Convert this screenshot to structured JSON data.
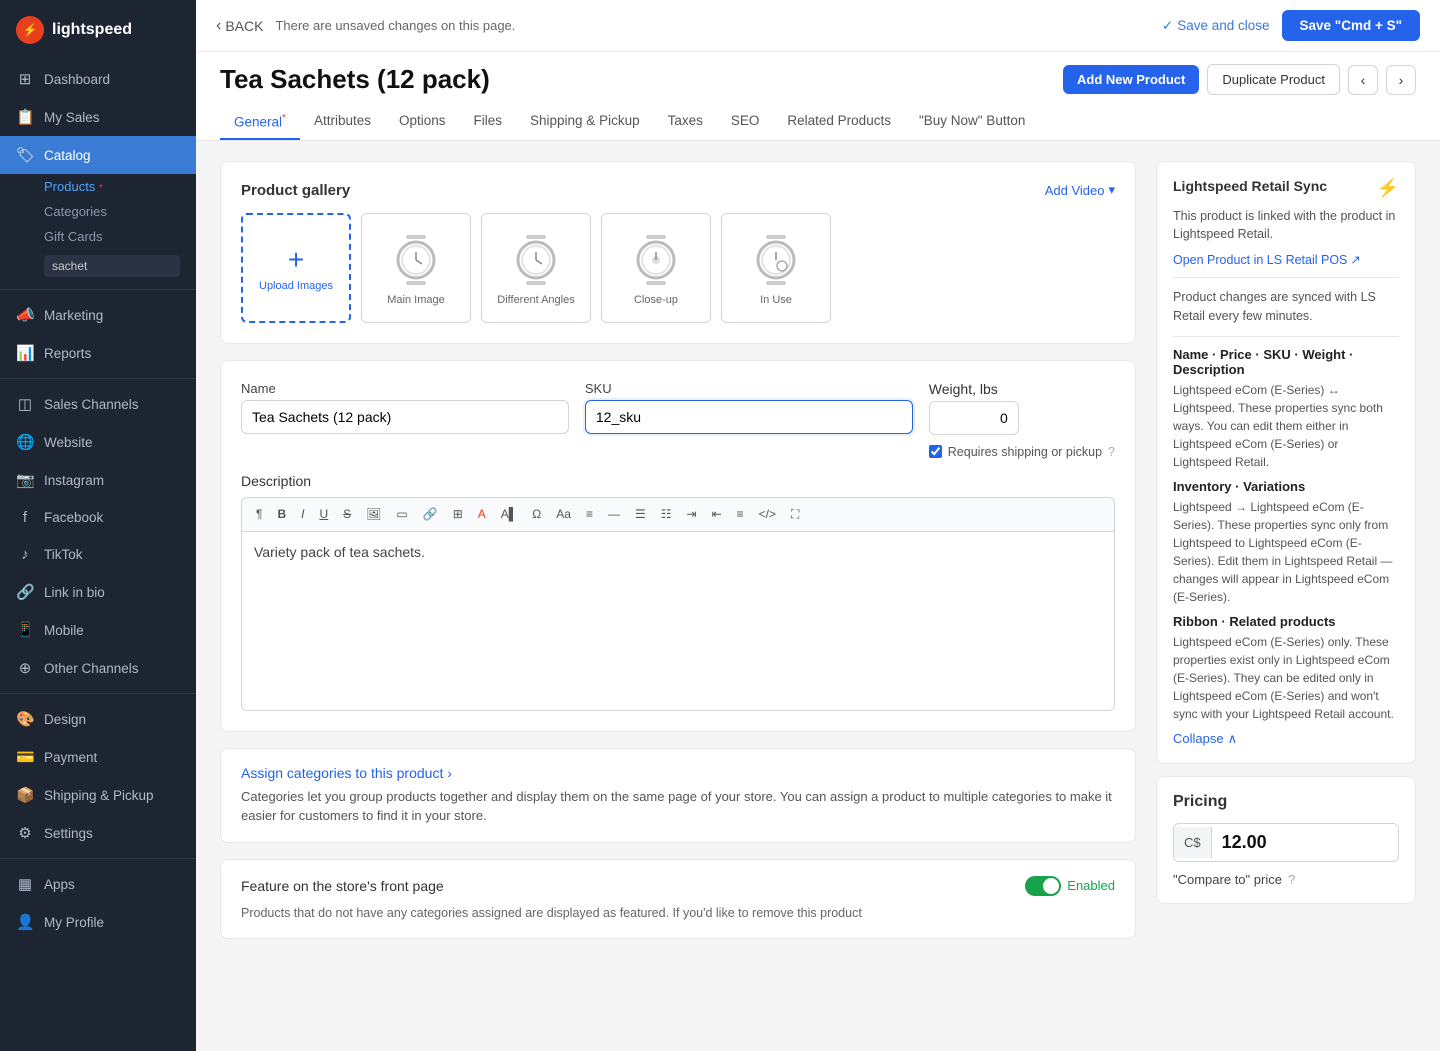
{
  "sidebar": {
    "logo_text": "lightspeed",
    "items": [
      {
        "id": "dashboard",
        "label": "Dashboard",
        "icon": "⊞"
      },
      {
        "id": "my-sales",
        "label": "My Sales",
        "icon": "📋"
      },
      {
        "id": "catalog",
        "label": "Catalog",
        "icon": "🏷",
        "active": true
      }
    ],
    "catalog_sub": [
      {
        "id": "products",
        "label": "Products",
        "active": true
      },
      {
        "id": "categories",
        "label": "Categories"
      },
      {
        "id": "gift-cards",
        "label": "Gift Cards"
      }
    ],
    "search_placeholder": "sachet",
    "other_items": [
      {
        "id": "marketing",
        "label": "Marketing",
        "icon": "📣"
      },
      {
        "id": "reports",
        "label": "Reports",
        "icon": "📊"
      },
      {
        "id": "sales-channels",
        "label": "Sales Channels",
        "icon": "◫"
      },
      {
        "id": "website",
        "label": "Website",
        "icon": "🌐"
      },
      {
        "id": "instagram",
        "label": "Instagram",
        "icon": "📷"
      },
      {
        "id": "facebook",
        "label": "Facebook",
        "icon": "f"
      },
      {
        "id": "tiktok",
        "label": "TikTok",
        "icon": "♪"
      },
      {
        "id": "link-in-bio",
        "label": "Link in bio",
        "icon": "🔗"
      },
      {
        "id": "mobile",
        "label": "Mobile",
        "icon": "📱"
      },
      {
        "id": "other-channels",
        "label": "Other Channels",
        "icon": "⊕"
      },
      {
        "id": "design",
        "label": "Design",
        "icon": "🎨"
      },
      {
        "id": "payment",
        "label": "Payment",
        "icon": "💳"
      },
      {
        "id": "shipping",
        "label": "Shipping & Pickup",
        "icon": "📦"
      },
      {
        "id": "settings",
        "label": "Settings",
        "icon": "⚙"
      },
      {
        "id": "apps",
        "label": "Apps",
        "icon": "▦"
      },
      {
        "id": "my-profile",
        "label": "My Profile",
        "icon": "👤"
      }
    ]
  },
  "topbar": {
    "back_label": "BACK",
    "unsaved_message": "There are unsaved changes on this page.",
    "save_close_label": "Save and close",
    "save_primary_label": "Save \"Cmd + S\""
  },
  "page": {
    "title": "Tea Sachets (12 pack)",
    "add_new_label": "Add New Product",
    "duplicate_label": "Duplicate Product"
  },
  "tabs": [
    {
      "id": "general",
      "label": "General",
      "active": true,
      "required": true
    },
    {
      "id": "attributes",
      "label": "Attributes"
    },
    {
      "id": "options",
      "label": "Options"
    },
    {
      "id": "files",
      "label": "Files"
    },
    {
      "id": "shipping-pickup",
      "label": "Shipping & Pickup"
    },
    {
      "id": "taxes",
      "label": "Taxes"
    },
    {
      "id": "seo",
      "label": "SEO"
    },
    {
      "id": "related-products",
      "label": "Related Products"
    },
    {
      "id": "buy-now",
      "label": "\"Buy Now\" Button"
    }
  ],
  "gallery": {
    "title": "Product gallery",
    "add_video_label": "Add Video",
    "upload_label": "Upload Images",
    "images": [
      {
        "id": "main",
        "label": "Main Image"
      },
      {
        "id": "angles",
        "label": "Different Angles"
      },
      {
        "id": "closeup",
        "label": "Close-up"
      },
      {
        "id": "inuse",
        "label": "In Use"
      }
    ]
  },
  "form": {
    "name_label": "Name",
    "name_value": "Tea Sachets (12 pack)",
    "sku_label": "SKU",
    "sku_value": "12_sku",
    "weight_label": "Weight, lbs",
    "weight_value": "0",
    "shipping_label": "Requires shipping or pickup",
    "desc_label": "Description",
    "desc_value": "Variety pack of tea sachets."
  },
  "categories": {
    "link_label": "Assign categories to this product",
    "description": "Categories let you group products together and display them on the same page of your store. You can assign a product to multiple categories to make it easier for customers to find it in your store."
  },
  "feature": {
    "label": "Feature on the store's front page",
    "toggle_label": "Enabled",
    "description": "Products that do not have any categories assigned are displayed as featured. If you'd like to remove this product"
  },
  "sync": {
    "title": "Lightspeed Retail Sync",
    "linked_text": "This product is linked with the product in Lightspeed Retail.",
    "open_link": "Open Product in LS Retail POS",
    "synced_text": "Product changes are synced with LS Retail every few minutes.",
    "section1_title": "Name · Price · SKU · Weight · Description",
    "section1_text": "Lightspeed eCom (E-Series) ↔ Lightspeed. These properties sync both ways. You can edit them either in Lightspeed eCom (E-Series) or Lightspeed Retail.",
    "section2_title": "Inventory · Variations",
    "section2_text": "Lightspeed → Lightspeed eCom (E-Series). These properties sync only from Lightspeed to Lightspeed eCom (E-Series). Edit them in Lightspeed Retail — changes will appear in Lightspeed eCom (E-Series).",
    "section3_title": "Ribbon · Related products",
    "section3_text": "Lightspeed eCom (E-Series) only. These properties exist only in Lightspeed eCom (E-Series). They can be edited only in Lightspeed eCom (E-Series) and won't sync with your Lightspeed Retail account.",
    "collapse_label": "Collapse"
  },
  "pricing": {
    "title": "Pricing",
    "currency": "C$",
    "price": "12.00",
    "compare_label": "\"Compare to\" price"
  }
}
